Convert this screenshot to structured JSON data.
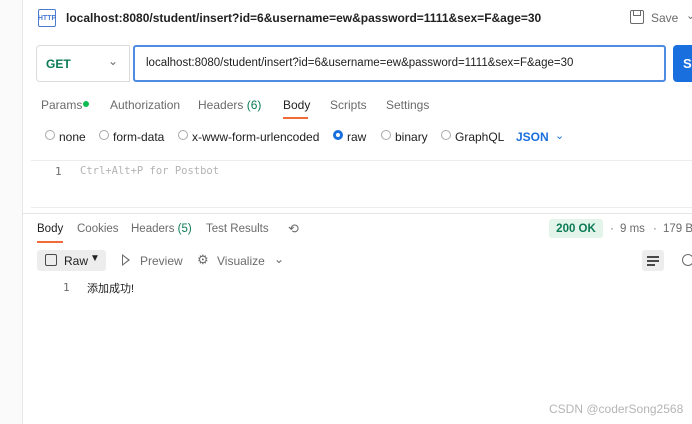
{
  "request": {
    "title": "localhost:8080/student/insert?id=6&username=ew&password=1111&sex=F&age=30",
    "save_label": "Save",
    "method": "GET",
    "url": "localhost:8080/student/insert?id=6&username=ew&password=1111&sex=F&age=30",
    "send_label": "S"
  },
  "request_tabs": {
    "params": "Params",
    "authorization": "Authorization",
    "headers": "Headers",
    "headers_count": "(6)",
    "body": "Body",
    "scripts": "Scripts",
    "settings": "Settings"
  },
  "body_types": {
    "none": "none",
    "form_data": "form-data",
    "urlencoded": "x-www-form-urlencoded",
    "raw": "raw",
    "binary": "binary",
    "graphql": "GraphQL",
    "format": "JSON",
    "selected": "raw"
  },
  "editor": {
    "line_number": "1",
    "placeholder": "Ctrl+Alt+P for Postbot"
  },
  "response_tabs": {
    "body": "Body",
    "cookies": "Cookies",
    "headers": "Headers",
    "headers_count": "(5)",
    "test_results": "Test Results"
  },
  "response_meta": {
    "status": "200 OK",
    "time": "9 ms",
    "size": "179 B"
  },
  "response_toolbar": {
    "raw": "Raw",
    "preview": "Preview",
    "visualize": "Visualize"
  },
  "response_body": {
    "line_number": "1",
    "text": "添加成功!"
  },
  "watermark": "CSDN @coderSong2568",
  "colors": {
    "accent": "#1a6fde",
    "method_green": "#0a7b55",
    "tab_underline": "#f26b3a",
    "status_bg": "#e3f5eb"
  }
}
